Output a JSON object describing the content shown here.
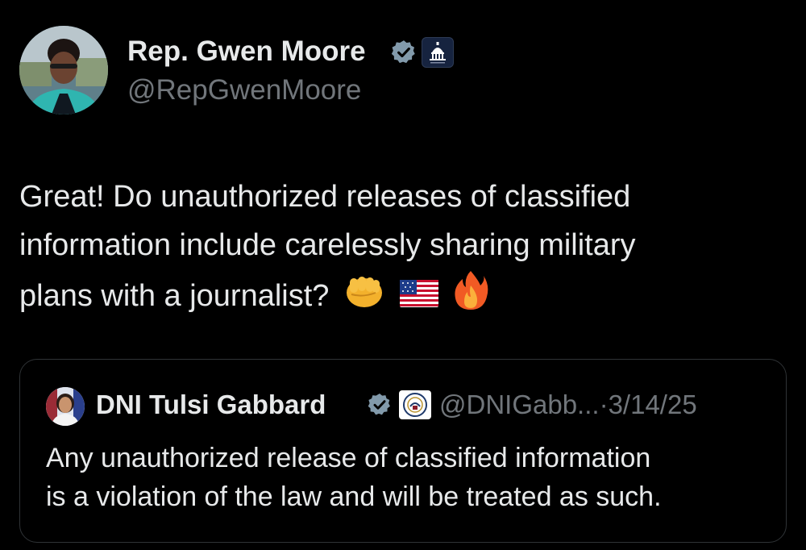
{
  "author": {
    "name": "Rep. Gwen Moore",
    "handle": "@RepGwenMoore",
    "verified_color": "#829aab"
  },
  "tweet": {
    "lines": [
      "Great! Do unauthorized releases of classified",
      "information include carelessly sharing military",
      "plans with a journalist?"
    ],
    "emojis": [
      "fist-emoji",
      "us-flag-emoji",
      "fire-emoji"
    ]
  },
  "quote": {
    "name": "DNI Tulsi Gabbard",
    "handle": "@DNIGabb...",
    "separator": "·",
    "date": "3/14/25",
    "lines": [
      "Any unauthorized release of classified information",
      "is a violation of the law and will be treated as such."
    ]
  },
  "colors": {
    "background": "#000000",
    "text": "#e7e9ea",
    "secondary": "#71767b",
    "border": "#2f3336"
  }
}
